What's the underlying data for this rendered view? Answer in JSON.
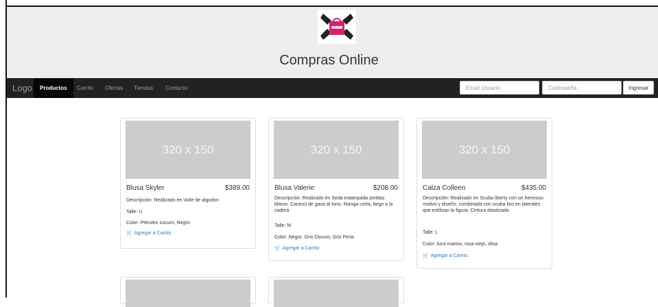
{
  "header": {
    "title": "Compras Online",
    "logo_icon": "shopping-bag-logo-icon"
  },
  "navbar": {
    "brand": "Logo",
    "items": [
      {
        "label": "Productos",
        "active": true
      },
      {
        "label": "Carrito"
      },
      {
        "label": "Ofertas"
      },
      {
        "label": "Tiendas"
      },
      {
        "label": "Contacto"
      }
    ],
    "email_placeholder": "Email Usuario",
    "password_placeholder": "Contraseña",
    "login_label": "Ingresar"
  },
  "products": [
    {
      "image_text": "320 x 150",
      "name": "Blusa Skyler",
      "price": "$389.00",
      "description": "Descripción: Realizado en Voile de algodon",
      "size": "Talle: U",
      "color": "Color: Petroleo oscuro, Negro",
      "cart_label": "Agregar a Carrito"
    },
    {
      "image_text": "320 x 150",
      "name": "Blusa Valerie",
      "price": "$208.00",
      "description": "Descripción: Realizado en Seda estampada pintitas bitono. Canesú de gasa al tono. Manga corta, largo a la cadera",
      "size": "Talle: M",
      "color": "Color: Negro, Gris Oscuro, Gris Perla",
      "cart_label": "Agregar a Carrito"
    },
    {
      "image_text": "320 x 150",
      "name": "Calza Colleen",
      "price": "$435.00",
      "description": "Descripción: Realizado en Scuba liberty con un hermoso motivo y diseño, combinada con scuba liso en laterales que estilizan la figura. Cintura elastizada",
      "size": "Talle: L",
      "color": "Color: Azul marino, rosa viejo, oliva",
      "cart_label": "Agregar a Carrito"
    }
  ],
  "colors": {
    "navbar_bg": "#222222",
    "header_bg": "#eeeeee",
    "link": "#337ab7",
    "placeholder_img": "#cccccc"
  }
}
